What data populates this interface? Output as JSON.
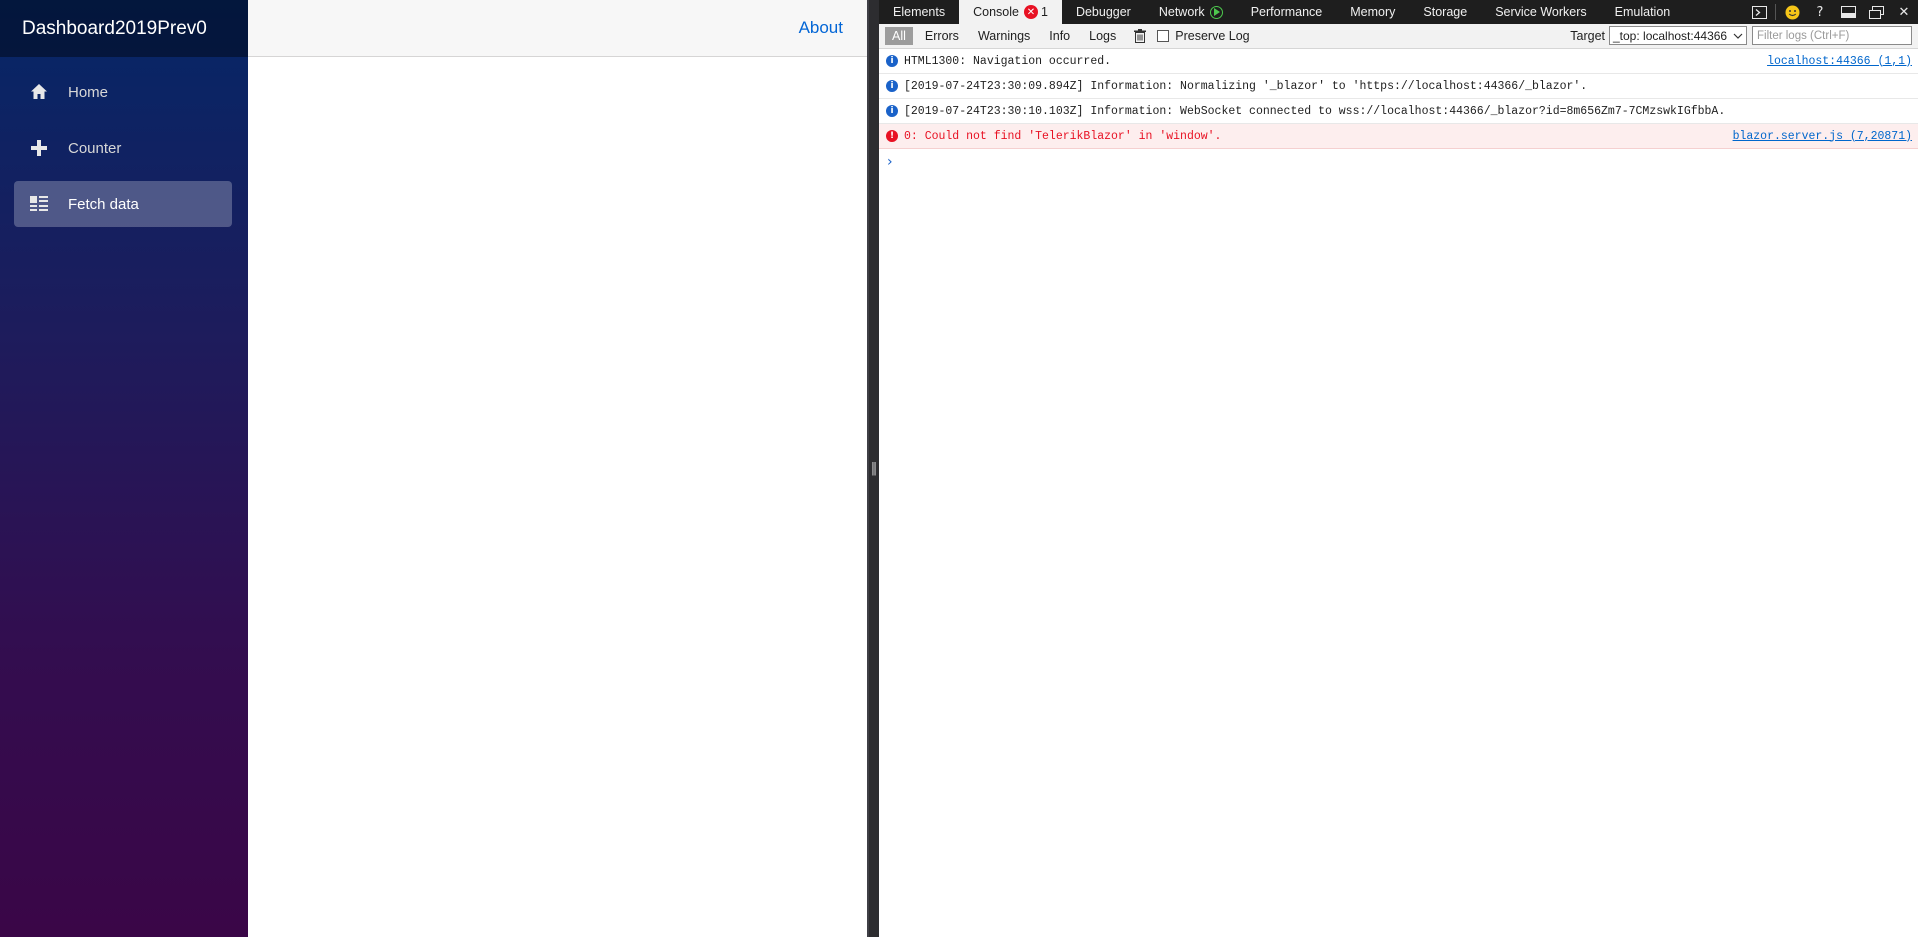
{
  "app": {
    "brand": "Dashboard2019Prev0",
    "nav": [
      {
        "label": "Home",
        "icon": "home-icon"
      },
      {
        "label": "Counter",
        "icon": "plus-icon"
      },
      {
        "label": "Fetch data",
        "icon": "list-icon",
        "active": true
      }
    ],
    "top_link": "About"
  },
  "devtools": {
    "tabs": [
      "Elements",
      "Console",
      "Debugger",
      "Network",
      "Performance",
      "Memory",
      "Storage",
      "Service Workers",
      "Emulation"
    ],
    "active_tab": "Console",
    "console_error_count": "1",
    "toolbar": {
      "filters": [
        "All",
        "Errors",
        "Warnings",
        "Info",
        "Logs"
      ],
      "active_filter": "All",
      "preserve_log": "Preserve Log",
      "target_label": "Target",
      "target_value": "_top: localhost:44366",
      "filter_placeholder": "Filter logs (Ctrl+F)"
    },
    "logs": [
      {
        "level": "info",
        "message": "HTML1300: Navigation occurred.",
        "source": "localhost:44366 (1,1)"
      },
      {
        "level": "info",
        "message": "[2019-07-24T23:30:09.894Z] Information: Normalizing '_blazor' to 'https://localhost:44366/_blazor'.",
        "source": ""
      },
      {
        "level": "info",
        "message": "[2019-07-24T23:30:10.103Z] Information: WebSocket connected to wss://localhost:44366/_blazor?id=8m656Zm7-7CMzswkIGfbbA.",
        "source": ""
      },
      {
        "level": "error",
        "message": "0: Could not find 'TelerikBlazor' in 'window'.",
        "source": "blazor.server.js (7,20871)"
      }
    ],
    "colors": {
      "error": "#e81123",
      "info": "#1a62c9",
      "link": "#0066cc"
    }
  }
}
